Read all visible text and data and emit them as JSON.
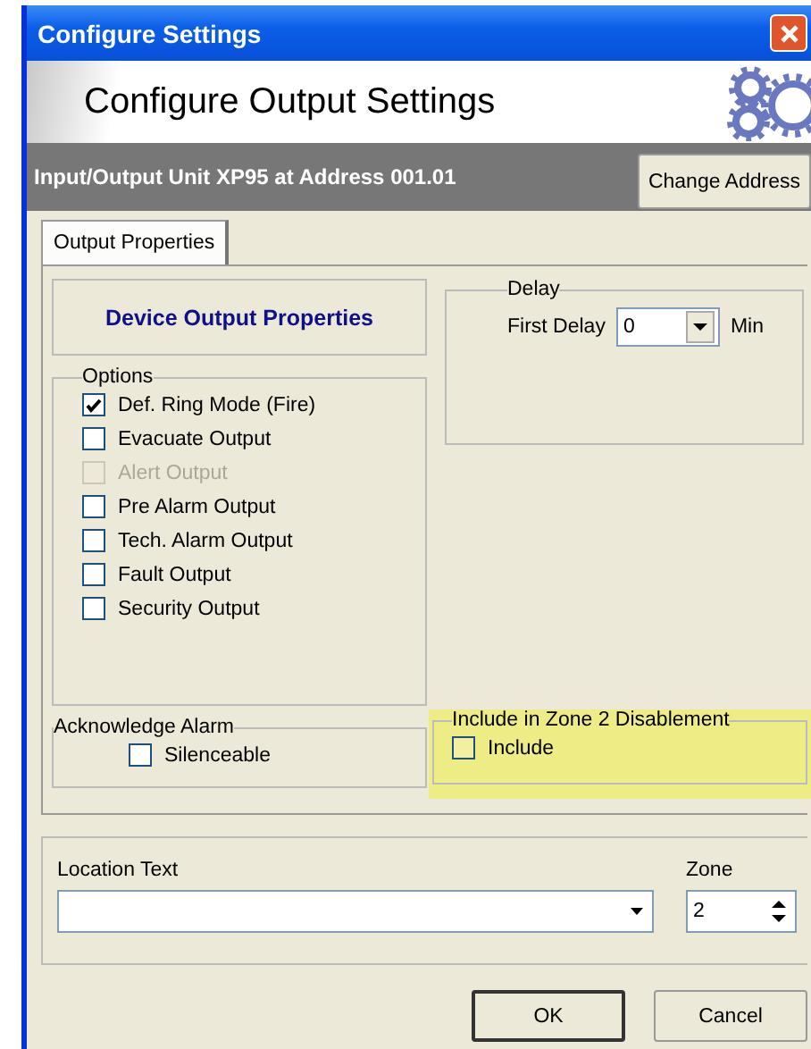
{
  "window": {
    "title": "Configure Settings"
  },
  "header": {
    "title": "Configure Output Settings"
  },
  "unit_bar": {
    "text": "Input/Output Unit XP95 at Address 001.01",
    "button": "Change Address"
  },
  "tabs": [
    {
      "label": "Output Properties",
      "selected": true
    }
  ],
  "panel_title": "Device Output Properties",
  "options": {
    "title": "Options",
    "items": [
      {
        "label": "Def. Ring Mode (Fire)",
        "checked": true,
        "disabled": false
      },
      {
        "label": "Evacuate Output",
        "checked": false,
        "disabled": false
      },
      {
        "label": "Alert Output",
        "checked": false,
        "disabled": true
      },
      {
        "label": "Pre Alarm Output",
        "checked": false,
        "disabled": false
      },
      {
        "label": "Tech. Alarm Output",
        "checked": false,
        "disabled": false
      },
      {
        "label": "Fault Output",
        "checked": false,
        "disabled": false
      },
      {
        "label": "Security Output",
        "checked": false,
        "disabled": false
      }
    ]
  },
  "delay": {
    "title": "Delay",
    "label": "First Delay",
    "value": "0",
    "unit": "Min"
  },
  "acknowledge_alarm": {
    "title": "Acknowledge Alarm",
    "items": [
      {
        "label": "Silenceable",
        "checked": false,
        "disabled": false
      }
    ]
  },
  "zone_disablement": {
    "title": "Include in Zone 2 Disablement",
    "highlighted": true,
    "items": [
      {
        "label": "Include",
        "checked": false,
        "disabled": false
      }
    ]
  },
  "location": {
    "label": "Location Text"
  },
  "zone": {
    "label": "Zone",
    "value": "2"
  },
  "buttons": [
    {
      "label": "OK",
      "default": true
    },
    {
      "label": "Cancel",
      "default": false
    }
  ]
}
